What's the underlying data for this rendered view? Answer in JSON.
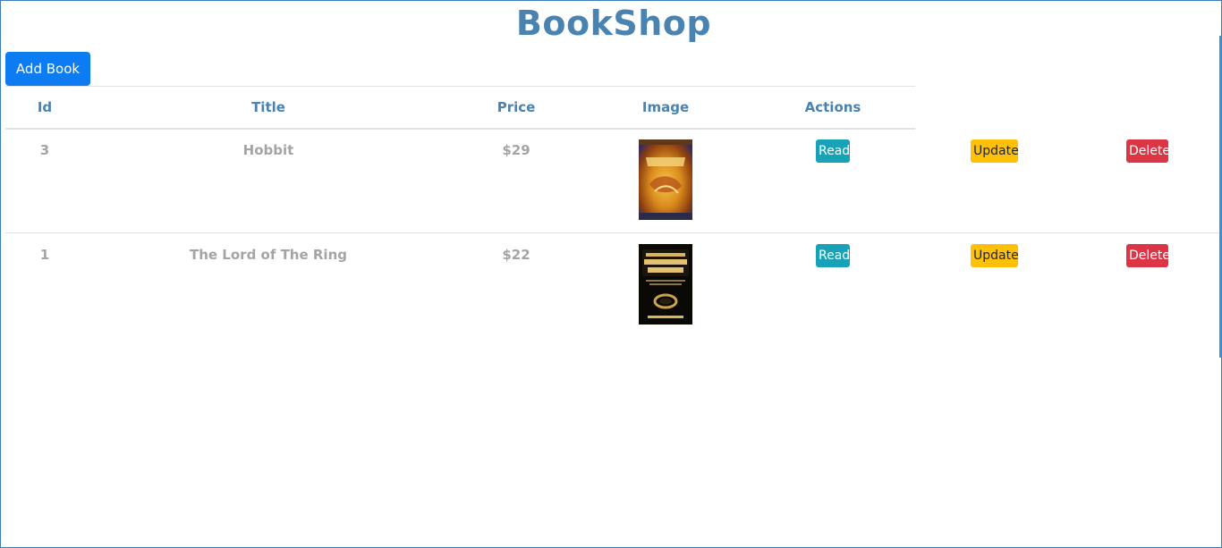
{
  "app": {
    "title": "BookShop",
    "add_button_label": "Add Book"
  },
  "table": {
    "columns": [
      "Id",
      "Title",
      "Price",
      "Image",
      "Actions"
    ],
    "rows": [
      {
        "id": "3",
        "title": "Hobbit",
        "price": "$29",
        "actions": {
          "read": "Read",
          "update": "Update",
          "delete": "Delete"
        }
      },
      {
        "id": "1",
        "title": "The Lord of The Ring",
        "price": "$22",
        "actions": {
          "read": "Read",
          "update": "Update",
          "delete": "Delete"
        }
      }
    ]
  },
  "colors": {
    "title": "#4a82b0",
    "primary": "#0d7bf2",
    "info": "#17a2b8",
    "warning": "#ffc107",
    "danger": "#dc3545",
    "muted_text": "#a4a4a4"
  }
}
